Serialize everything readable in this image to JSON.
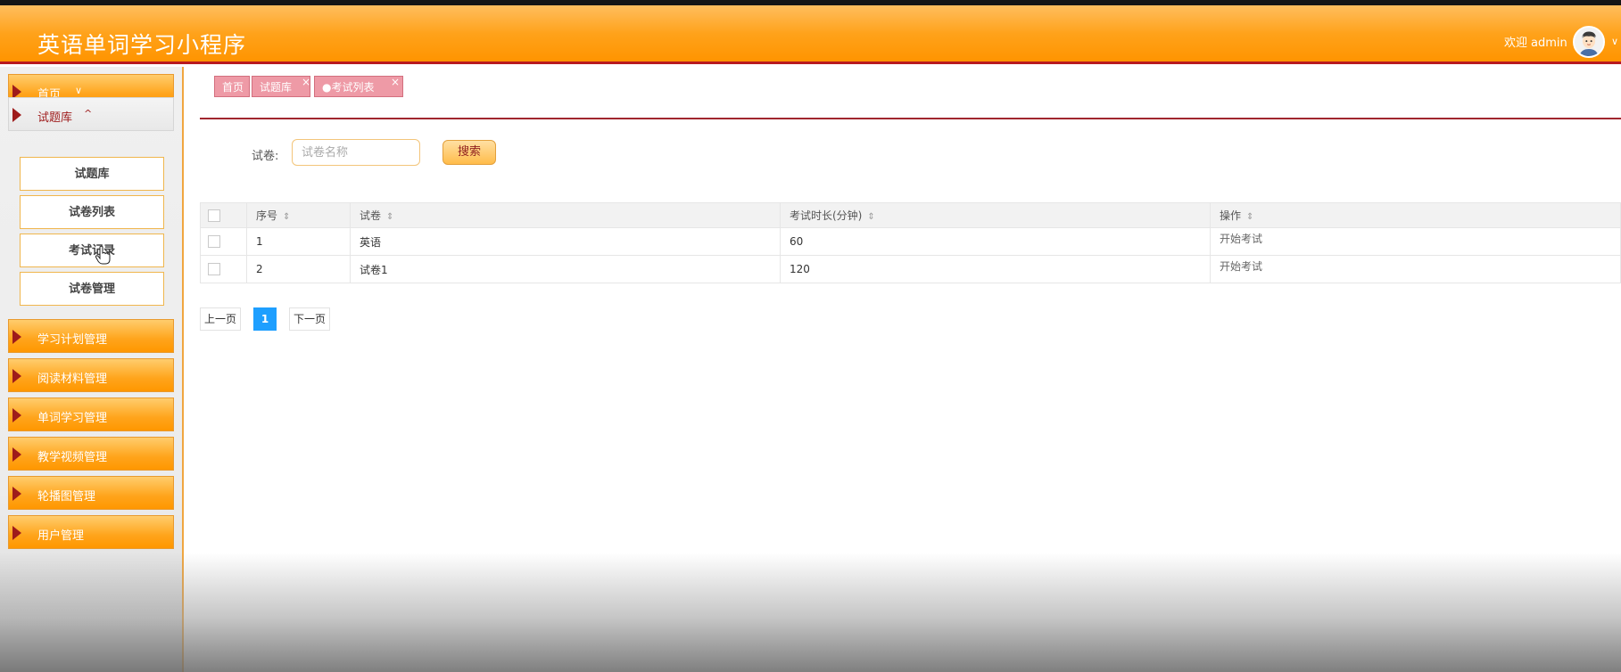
{
  "header": {
    "app_title": "英语单词学习小程序",
    "welcome_text": "欢迎",
    "username": "admin",
    "user_menu_chevron": "∨"
  },
  "sidebar": {
    "items": [
      {
        "label": "首页",
        "chevron": "∨",
        "expanded": false
      },
      {
        "label": "试题库",
        "chevron": "^",
        "expanded": true,
        "children": [
          "试题库",
          "试卷列表",
          "考试记录",
          "试卷管理"
        ]
      },
      {
        "label": "学习计划管理",
        "expanded": false
      },
      {
        "label": "阅读材料管理",
        "expanded": false
      },
      {
        "label": "单词学习管理",
        "expanded": false
      },
      {
        "label": "教学视频管理",
        "expanded": false
      },
      {
        "label": "轮播图管理",
        "expanded": false
      },
      {
        "label": "用户管理",
        "expanded": false
      }
    ]
  },
  "tabs": [
    {
      "label": "首页",
      "closable": false
    },
    {
      "label": "试题库",
      "closable": true
    },
    {
      "label": "●考试列表",
      "closable": true,
      "active": true
    }
  ],
  "tab_close_glyph": "×",
  "search": {
    "label": "试卷:",
    "placeholder": "试卷名称",
    "value": "",
    "button_label": "搜索"
  },
  "table": {
    "columns": [
      "序号",
      "试卷",
      "考试时长(分钟)",
      "操作"
    ],
    "sort_glyph": "⇕",
    "rows": [
      {
        "index": "1",
        "paper": "英语",
        "duration": "60",
        "action": "开始考试"
      },
      {
        "index": "2",
        "paper": "试卷1",
        "duration": "120",
        "action": "开始考试"
      }
    ]
  },
  "pagination": {
    "prev_label": "上一页",
    "current_page": "1",
    "next_label": "下一页"
  },
  "colors": {
    "header_orange": "#ffa21a",
    "accent_red": "#9e1b1b",
    "tab_pink": "#ee9aa6",
    "pager_blue": "#1e9fff"
  }
}
